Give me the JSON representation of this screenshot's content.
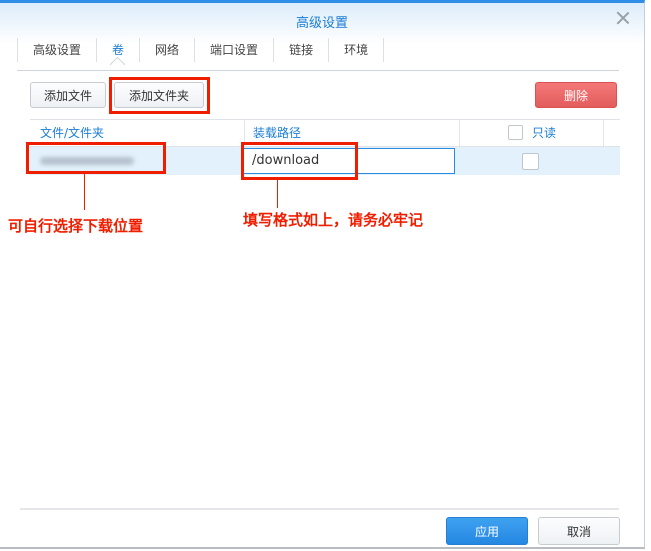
{
  "dialog": {
    "title": "高级设置",
    "close_icon": "close-icon",
    "tabs": [
      {
        "label": "高级设置",
        "active": false
      },
      {
        "label": "卷",
        "active": true
      },
      {
        "label": "网络",
        "active": false
      },
      {
        "label": "端口设置",
        "active": false
      },
      {
        "label": "链接",
        "active": false
      },
      {
        "label": "环境",
        "active": false
      }
    ]
  },
  "toolbar": {
    "add_file_label": "添加文件",
    "add_folder_label": "添加文件夹",
    "delete_label": "删除"
  },
  "table": {
    "columns": [
      "文件/文件夹",
      "装载路径",
      "只读"
    ],
    "rows": [
      {
        "file_folder": "(blurred)",
        "mount_path": "/download",
        "readonly": false
      }
    ]
  },
  "annotations": {
    "left_note": "可自行选择下载位置",
    "right_note": "填写格式如上，请务必牢记",
    "color": "#f01e00"
  },
  "footer": {
    "apply_label": "应用",
    "cancel_label": "取消"
  }
}
